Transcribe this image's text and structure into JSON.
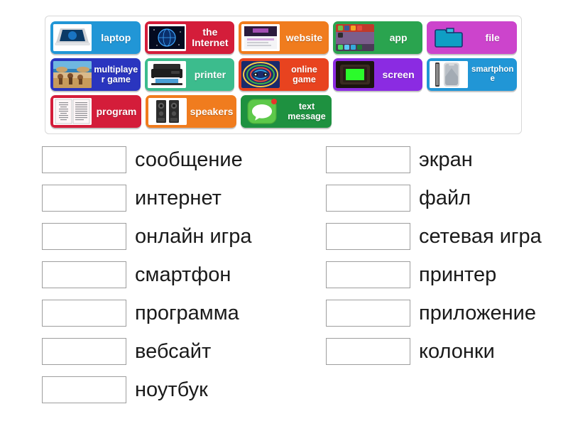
{
  "tile_bank": {
    "rows": [
      [
        {
          "label": "laptop",
          "bg": "#2196d6",
          "icon": "laptop-thumb",
          "size": "normal"
        },
        {
          "label": "the Internet",
          "bg": "#d41d3a",
          "icon": "internet-globe-thumb",
          "size": "normal"
        },
        {
          "label": "website",
          "bg": "#f07c1e",
          "icon": "website-page-thumb",
          "size": "normal"
        },
        {
          "label": "app",
          "bg": "#2aa44f",
          "icon": "app-phone-thumb",
          "size": "normal"
        },
        {
          "label": "file",
          "bg": "#cc44cc",
          "icon": "folder-icon",
          "size": "normal"
        }
      ],
      [
        {
          "label": "multiplayer game",
          "bg": "#2a35bf",
          "icon": "multiplayer-game-thumb",
          "size": "small"
        },
        {
          "label": "printer",
          "bg": "#3cbc8d",
          "icon": "printer-thumb",
          "size": "normal"
        },
        {
          "label": "online game",
          "bg": "#e8431f",
          "icon": "online-game-thumb",
          "size": "small"
        },
        {
          "label": "screen",
          "bg": "#8b2be2",
          "icon": "screen-thumb",
          "size": "normal"
        },
        {
          "label": "smartphone",
          "bg": "#2196d6",
          "icon": "smartphone-thumb",
          "size": "tiny"
        }
      ],
      [
        {
          "label": "program",
          "bg": "#d41d3a",
          "icon": "program-document-thumb",
          "size": "normal"
        },
        {
          "label": "speakers",
          "bg": "#f07c1e",
          "icon": "speakers-thumb",
          "size": "normal"
        },
        {
          "label": "text message",
          "bg": "#1e9140",
          "icon": "text-message-thumb",
          "size": "small"
        }
      ]
    ]
  },
  "answers": {
    "left_column": [
      {
        "word": "сообщение"
      },
      {
        "word": "интернет"
      },
      {
        "word": "онлайн игра"
      },
      {
        "word": "смартфон"
      },
      {
        "word": "программа"
      },
      {
        "word": "вебсайт"
      },
      {
        "word": "ноутбук"
      }
    ],
    "right_column": [
      {
        "word": "экран"
      },
      {
        "word": "файл"
      },
      {
        "word": "сетевая игра"
      },
      {
        "word": "принтер"
      },
      {
        "word": "приложение"
      },
      {
        "word": "колонки"
      }
    ]
  },
  "colors": {
    "page_background": "#ffffff",
    "bank_border": "#d8d8d8",
    "drop_box_border": "#9e9e9e",
    "word_text": "#1a1a1a",
    "tile_text": "#ffffff"
  }
}
